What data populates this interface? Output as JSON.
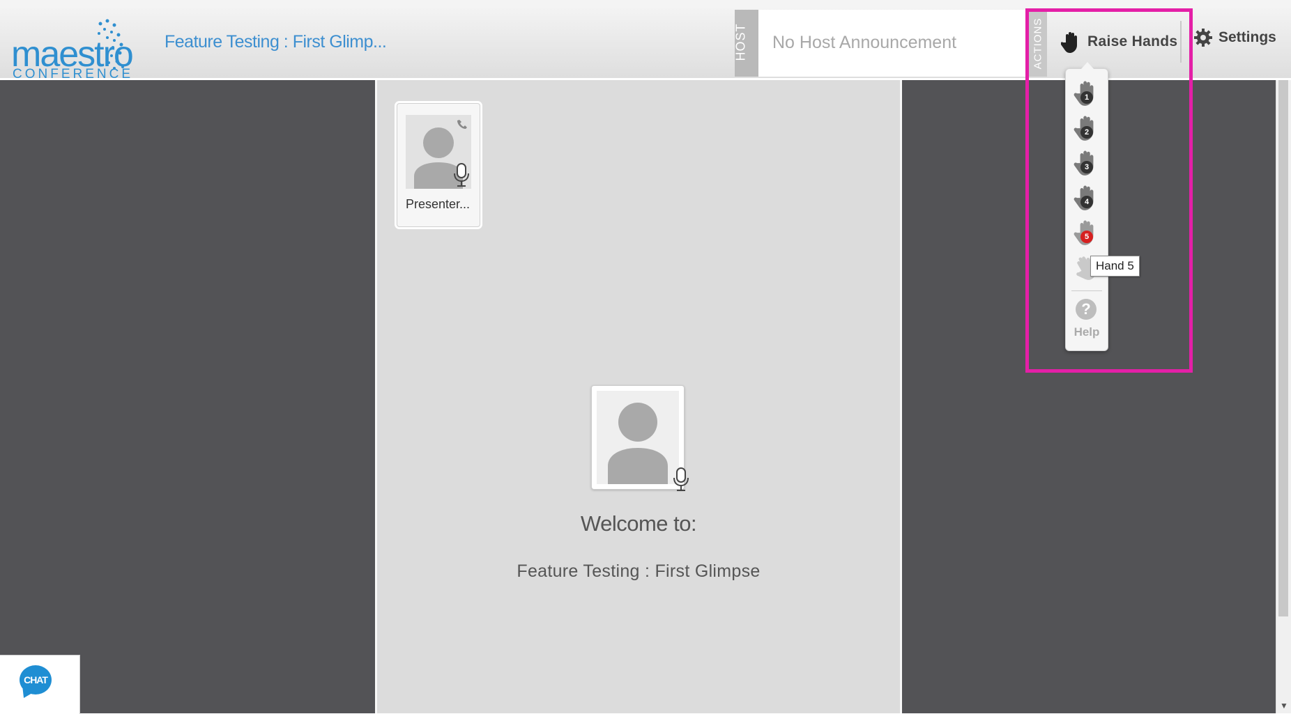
{
  "logo": {
    "word": "maestro",
    "sub": "CONFERENCE"
  },
  "header": {
    "conference_title": "Feature Testing : First Glimp...",
    "host_tab": "HOST",
    "announcement": "No Host Announcement",
    "actions_tab": "ACTIONS",
    "raise_hands_label": "Raise Hands",
    "settings_label": "Settings"
  },
  "raise_hands_menu": {
    "hands": [
      {
        "label": "1",
        "state": "normal"
      },
      {
        "label": "2",
        "state": "normal"
      },
      {
        "label": "3",
        "state": "normal"
      },
      {
        "label": "4",
        "state": "normal"
      },
      {
        "label": "5",
        "state": "active"
      }
    ],
    "lower_hand_icon": "lower-hand-icon",
    "help_label": "Help",
    "tooltip": "Hand 5"
  },
  "presenter": {
    "name": "Presenter..."
  },
  "welcome": {
    "heading": "Welcome to:",
    "subtitle": "Feature Testing : First Glimpse"
  },
  "chat": {
    "label": "CHAT"
  },
  "colors": {
    "brand_blue": "#2f8fd0",
    "highlight": "#e41fa7",
    "active_badge": "#d62020",
    "sidebar_bg": "#535356"
  }
}
